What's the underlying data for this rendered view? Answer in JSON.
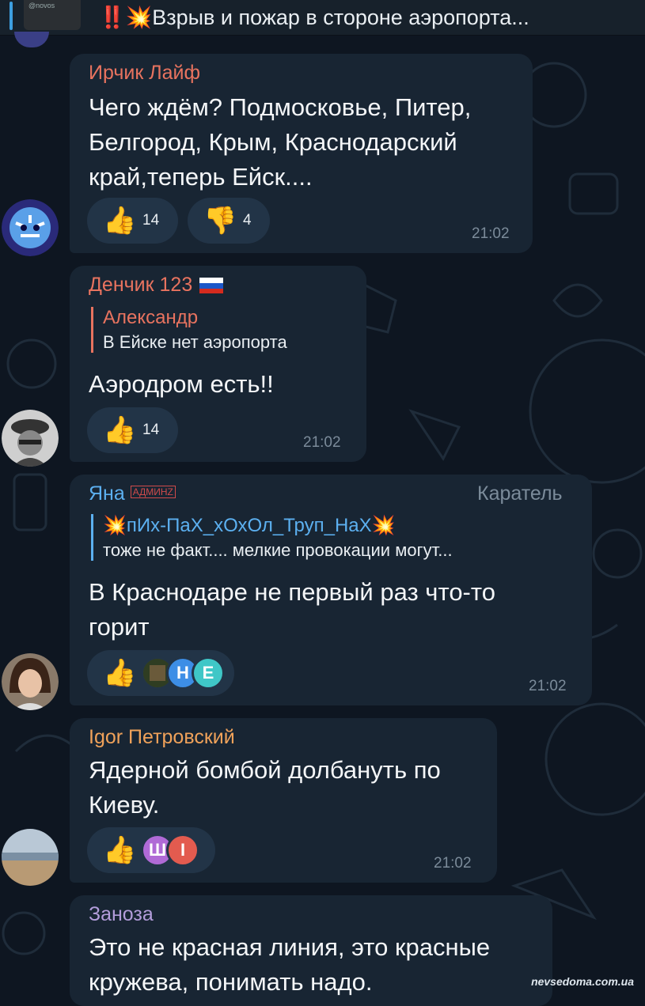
{
  "pinned": {
    "alarm": "‼️",
    "boom": "💥",
    "text": "Взрыв и пожар в стороне аэропорта...",
    "thumb_caption": "@novos"
  },
  "messages": [
    {
      "author": "Ирчик Лайф",
      "author_color": "#e8735f",
      "text_lines": [
        "Чего ждём? Подмосковье, Питер,",
        "Белгород, Крым, Краснодарский",
        "край,теперь Ейск...."
      ],
      "reactions": [
        {
          "icon": "👍",
          "count": "14"
        },
        {
          "icon": "👎",
          "count": "4"
        }
      ],
      "time": "21:02"
    },
    {
      "author": "Денчик 123",
      "author_flag": "russia-flag",
      "author_color": "#e8735f",
      "reply": {
        "name": "Александр",
        "text": "В Ейске нет аэропорта",
        "color": "#e8735f"
      },
      "text_lines": [
        "Аэродром есть!!"
      ],
      "reactions": [
        {
          "icon": "👍",
          "count": "14"
        }
      ],
      "time": "21:02"
    },
    {
      "author": "Яна",
      "author_badge": "АДМИНZ",
      "author_color": "#5cb0f0",
      "title": "Каратель",
      "reply": {
        "boom": "💥",
        "name": "пИх-ПаХ_хОхОл_Труп_НаХ",
        "text": "тоже не факт.... мелкие провокации могут...",
        "color": "#5cb0f0"
      },
      "text_lines": [
        "В Краснодаре не первый раз что-то",
        "горит"
      ],
      "reactions": [
        {
          "icon": "👍",
          "avatars": [
            "",
            "Н",
            "Е"
          ]
        }
      ],
      "time": "21:02"
    },
    {
      "author": "Igor Петровский",
      "author_color": "#f0a25a",
      "text_lines": [
        "Ядерной бомбой долбануть по",
        "Киеву."
      ],
      "reactions": [
        {
          "icon": "👍",
          "avatars": [
            "Ш",
            "I"
          ]
        }
      ],
      "time": "21:02"
    },
    {
      "author": "Заноза",
      "author_color": "#b39ddb",
      "text_lines": [
        "Это не красная линия, это красные",
        "кружева, понимать надо."
      ]
    }
  ],
  "watermark": "nevsedoma.com.ua"
}
